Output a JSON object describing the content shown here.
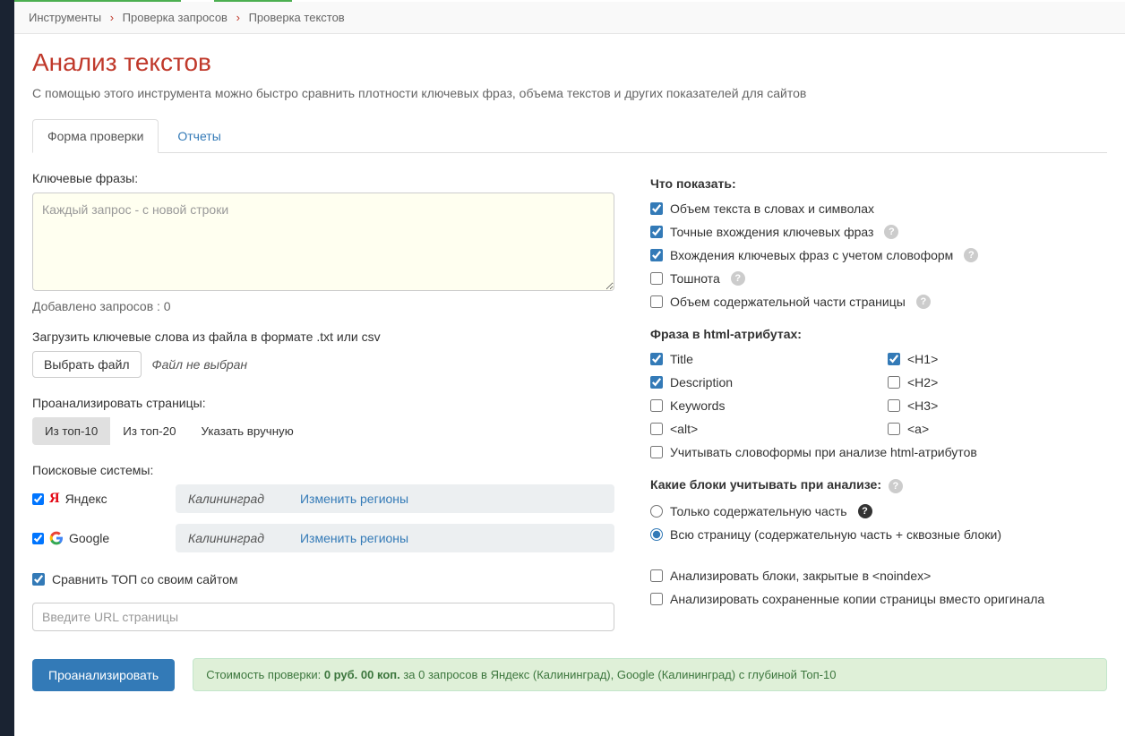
{
  "breadcrumb": {
    "items": [
      "Инструменты",
      "Проверка запросов",
      "Проверка текстов"
    ]
  },
  "page": {
    "title": "Анализ текстов",
    "subtitle": "С помощью этого инструмента можно быстро сравнить плотности ключевых фраз, объема текстов и других показателей для сайтов"
  },
  "tabs": {
    "form": "Форма проверки",
    "reports": "Отчеты"
  },
  "left": {
    "keyphrases_label": "Ключевые фразы:",
    "keyphrases_placeholder": "Каждый запрос - с новой строки",
    "added_count_prefix": "Добавлено запросов : ",
    "added_count": "0",
    "upload_label": "Загрузить ключевые слова из файла в формате .txt или csv",
    "file_button": "Выбрать файл",
    "file_status": "Файл не выбран",
    "analyze_label": "Проанализировать страницы:",
    "seg_top10": "Из топ-10",
    "seg_top20": "Из топ-20",
    "seg_manual": "Указать вручную",
    "engines_label": "Поисковые системы:",
    "yandex": "Яндекс",
    "google": "Google",
    "region_yandex": "Калининград",
    "region_google": "Калининград",
    "region_change": "Изменить регионы",
    "compare_label": "Сравнить ТОП со своим сайтом",
    "url_placeholder": "Введите URL страницы"
  },
  "right": {
    "show_label": "Что показать:",
    "show": {
      "volume": "Объем текста в словах и символах",
      "exact": "Точные вхождения ключевых фраз",
      "forms": "Вхождения ключевых фраз с учетом словоформ",
      "nausea": "Тошнота",
      "content_volume": "Объем содержательной части страницы"
    },
    "attrs_label": "Фраза в html-атрибутах:",
    "attrs": {
      "title": "Title",
      "description": "Description",
      "keywords": "Keywords",
      "alt": "<alt>",
      "h1": "<H1>",
      "h2": "<H2>",
      "h3": "<H3>",
      "a": "<a>"
    },
    "wordforms_attrs": "Учитывать словоформы при анализе html-атрибутов",
    "blocks_label": "Какие блоки учитывать при анализе:",
    "blocks_content": "Только содержательную часть",
    "blocks_full": "Всю страницу (содержательную часть + сквозные блоки)",
    "noindex": "Анализировать блоки, закрытые в <noindex>",
    "saved_copies": "Анализировать сохраненные копии страницы вместо оригинала"
  },
  "footer": {
    "analyze": "Проанализировать",
    "cost_prefix": "Стоимость проверки: ",
    "cost_value": "0 руб. 00 коп.",
    "cost_suffix": " за 0 запросов в Яндекс (Калининград), Google (Калининград) с глубиной Топ-10"
  }
}
